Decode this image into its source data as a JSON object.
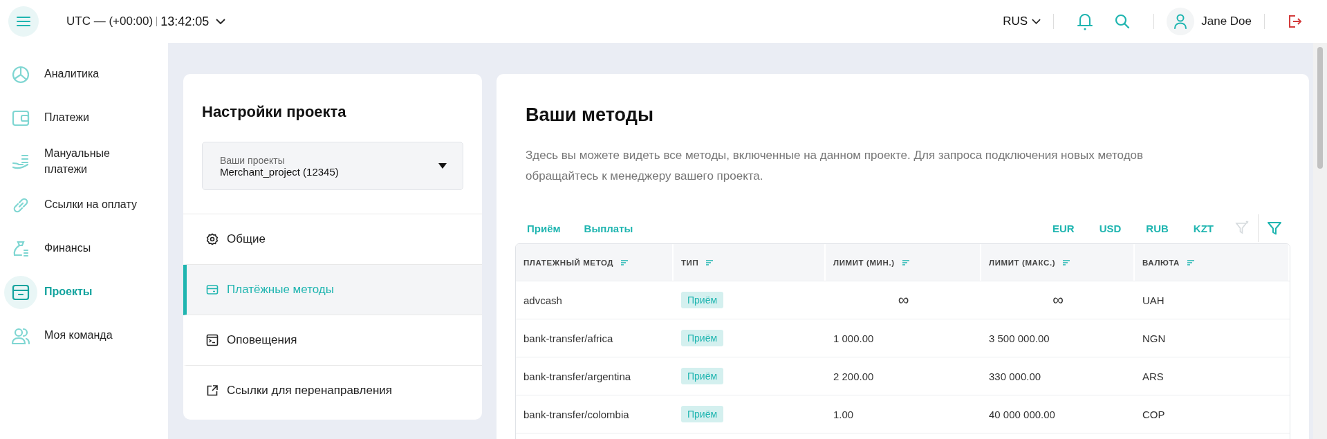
{
  "header": {
    "timezone": "UTC — (+00:00)",
    "time": "13:42:05",
    "language": "RUS",
    "user_name": "Jane Doe"
  },
  "sidebar": {
    "items": [
      {
        "label": "Аналитика",
        "selected": false
      },
      {
        "label": "Платежи",
        "selected": false
      },
      {
        "label": "Мануальные платежи",
        "selected": false
      },
      {
        "label": "Ссылки на оплату",
        "selected": false
      },
      {
        "label": "Финансы",
        "selected": false
      },
      {
        "label": "Проекты",
        "selected": true
      },
      {
        "label": "Моя команда",
        "selected": false
      }
    ]
  },
  "settings": {
    "title": "Настройки проекта",
    "project_select": {
      "label": "Ваши проекты",
      "value": "Merchant_project (12345)"
    },
    "menu": [
      {
        "label": "Общие",
        "selected": false
      },
      {
        "label": "Платёжные методы",
        "selected": true
      },
      {
        "label": "Оповещения",
        "selected": false
      },
      {
        "label": "Ссылки для перенаправления",
        "selected": false
      }
    ]
  },
  "methods": {
    "title": "Ваши методы",
    "description": "Здесь вы можете видеть все методы, включенные на данном проекте. Для запроса подключения новых методов обращайтесь к менеджеру вашего проекта.",
    "type_filters": [
      "Приём",
      "Выплаты"
    ],
    "currency_filters": [
      "EUR",
      "USD",
      "RUB",
      "KZT"
    ],
    "table": {
      "columns": [
        "ПЛАТЕЖНЫЙ МЕТОД",
        "ТИП",
        "ЛИМИТ (МИН.)",
        "ЛИМИТ (МАКС.)",
        "ВАЛЮТА"
      ],
      "rows": [
        {
          "method": "advcash",
          "type": "Приём",
          "min": {
            "value": "∞",
            "unlimited": true
          },
          "max": {
            "value": "∞",
            "unlimited": true
          },
          "currency": "UAH"
        },
        {
          "method": "bank-transfer/africa",
          "type": "Приём",
          "min": {
            "value": "1 000.00",
            "unlimited": false
          },
          "max": {
            "value": "3 500 000.00",
            "unlimited": false
          },
          "currency": "NGN"
        },
        {
          "method": "bank-transfer/argentina",
          "type": "Приём",
          "min": {
            "value": "2 200.00",
            "unlimited": false
          },
          "max": {
            "value": "330 000.00",
            "unlimited": false
          },
          "currency": "ARS"
        },
        {
          "method": "bank-transfer/colombia",
          "type": "Приём",
          "min": {
            "value": "1.00",
            "unlimited": false
          },
          "max": {
            "value": "40 000 000.00",
            "unlimited": false
          },
          "currency": "COP"
        }
      ]
    }
  }
}
